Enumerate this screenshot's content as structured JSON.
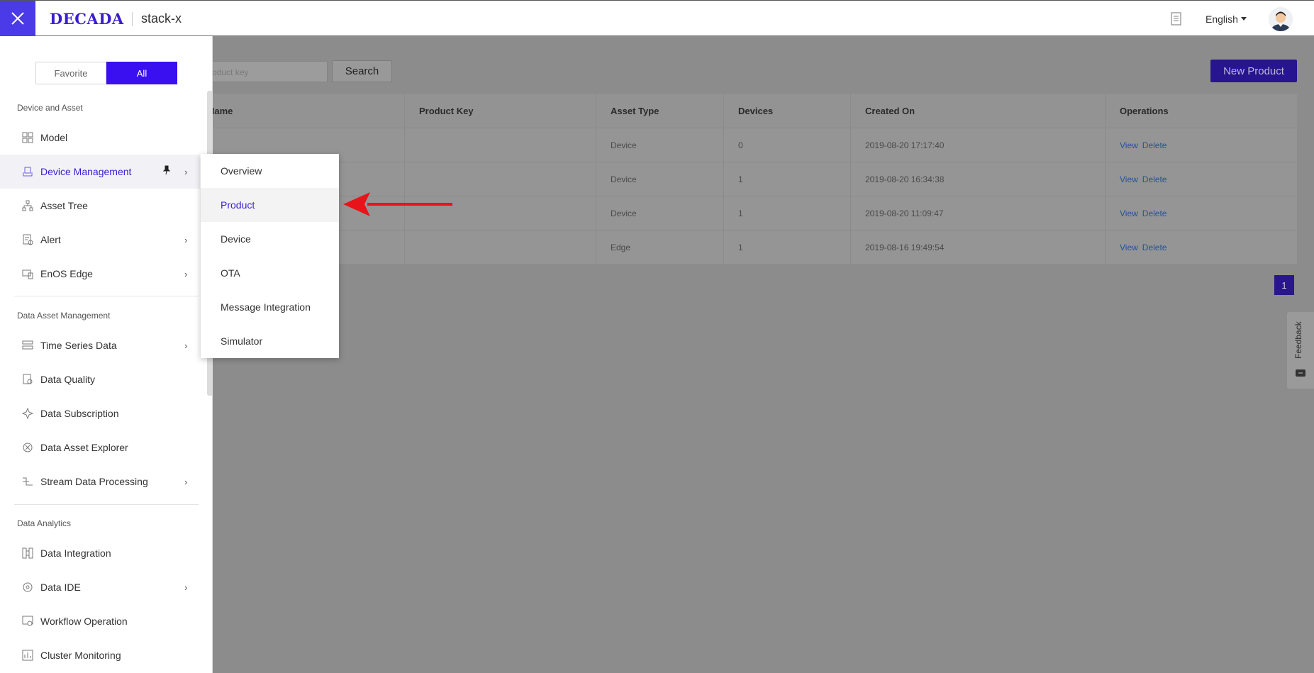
{
  "header": {
    "logo": "DECADA",
    "tenant": "stack-x",
    "language": "English"
  },
  "toolbar": {
    "search_placeholder": "Product key",
    "search_label": "Search",
    "new_product_label": "New Product"
  },
  "table": {
    "columns": [
      "Name",
      "Product Key",
      "Asset Type",
      "Devices",
      "Created On",
      "Operations"
    ],
    "rows": [
      {
        "asset_type": "Device",
        "devices": "0",
        "created_on": "2019-08-20 17:17:40",
        "view": "View",
        "delete": "Delete"
      },
      {
        "asset_type": "Device",
        "devices": "1",
        "created_on": "2019-08-20 16:34:38",
        "view": "View",
        "delete": "Delete"
      },
      {
        "asset_type": "Device",
        "devices": "1",
        "created_on": "2019-08-20 11:09:47",
        "view": "View",
        "delete": "Delete"
      },
      {
        "asset_type": "Edge",
        "devices": "1",
        "created_on": "2019-08-16 19:49:54",
        "view": "View",
        "delete": "Delete"
      }
    ]
  },
  "pagination": {
    "current": "1"
  },
  "feedback": "Feedback",
  "sidebar": {
    "toggle": {
      "favorite": "Favorite",
      "all": "All"
    },
    "sections": {
      "device_asset": "Device and Asset",
      "data_asset_mgmt": "Data Asset Management",
      "data_analytics": "Data Analytics"
    },
    "items": {
      "model": "Model",
      "device_management": "Device Management",
      "asset_tree": "Asset Tree",
      "alert": "Alert",
      "enos_edge": "EnOS Edge",
      "time_series": "Time Series Data",
      "data_quality": "Data Quality",
      "data_subscription": "Data Subscription",
      "data_asset_explorer": "Data Asset Explorer",
      "stream_processing": "Stream Data Processing",
      "data_integration": "Data Integration",
      "data_ide": "Data IDE",
      "workflow": "Workflow Operation",
      "cluster": "Cluster Monitoring"
    }
  },
  "submenu": {
    "overview": "Overview",
    "product": "Product",
    "device": "Device",
    "ota": "OTA",
    "message_integration": "Message Integration",
    "simulator": "Simulator"
  },
  "colors": {
    "brand": "#3a1ed0",
    "accent_button": "#3a10f0",
    "arrow": "#e8141a"
  }
}
